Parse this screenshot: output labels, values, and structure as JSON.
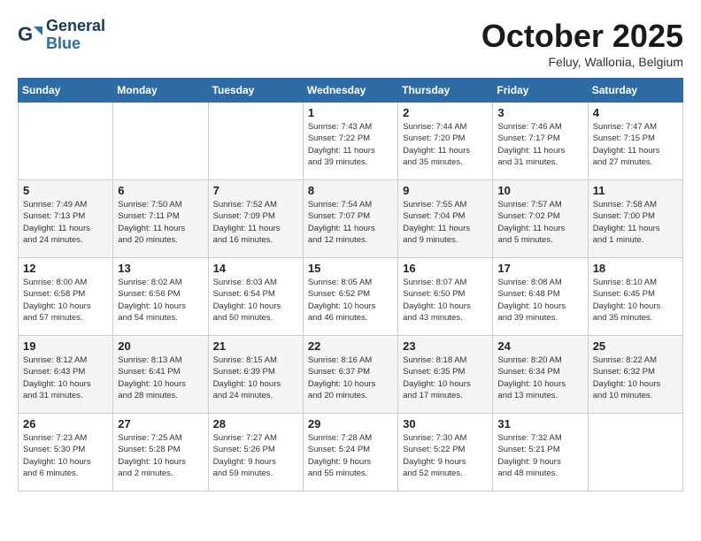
{
  "logo": {
    "line1": "General",
    "line2": "Blue"
  },
  "header": {
    "month": "October 2025",
    "location": "Feluy, Wallonia, Belgium"
  },
  "weekdays": [
    "Sunday",
    "Monday",
    "Tuesday",
    "Wednesday",
    "Thursday",
    "Friday",
    "Saturday"
  ],
  "weeks": [
    [
      {
        "day": "",
        "info": ""
      },
      {
        "day": "",
        "info": ""
      },
      {
        "day": "",
        "info": ""
      },
      {
        "day": "1",
        "info": "Sunrise: 7:43 AM\nSunset: 7:22 PM\nDaylight: 11 hours\nand 39 minutes."
      },
      {
        "day": "2",
        "info": "Sunrise: 7:44 AM\nSunset: 7:20 PM\nDaylight: 11 hours\nand 35 minutes."
      },
      {
        "day": "3",
        "info": "Sunrise: 7:46 AM\nSunset: 7:17 PM\nDaylight: 11 hours\nand 31 minutes."
      },
      {
        "day": "4",
        "info": "Sunrise: 7:47 AM\nSunset: 7:15 PM\nDaylight: 11 hours\nand 27 minutes."
      }
    ],
    [
      {
        "day": "5",
        "info": "Sunrise: 7:49 AM\nSunset: 7:13 PM\nDaylight: 11 hours\nand 24 minutes."
      },
      {
        "day": "6",
        "info": "Sunrise: 7:50 AM\nSunset: 7:11 PM\nDaylight: 11 hours\nand 20 minutes."
      },
      {
        "day": "7",
        "info": "Sunrise: 7:52 AM\nSunset: 7:09 PM\nDaylight: 11 hours\nand 16 minutes."
      },
      {
        "day": "8",
        "info": "Sunrise: 7:54 AM\nSunset: 7:07 PM\nDaylight: 11 hours\nand 12 minutes."
      },
      {
        "day": "9",
        "info": "Sunrise: 7:55 AM\nSunset: 7:04 PM\nDaylight: 11 hours\nand 9 minutes."
      },
      {
        "day": "10",
        "info": "Sunrise: 7:57 AM\nSunset: 7:02 PM\nDaylight: 11 hours\nand 5 minutes."
      },
      {
        "day": "11",
        "info": "Sunrise: 7:58 AM\nSunset: 7:00 PM\nDaylight: 11 hours\nand 1 minute."
      }
    ],
    [
      {
        "day": "12",
        "info": "Sunrise: 8:00 AM\nSunset: 6:58 PM\nDaylight: 10 hours\nand 57 minutes."
      },
      {
        "day": "13",
        "info": "Sunrise: 8:02 AM\nSunset: 6:56 PM\nDaylight: 10 hours\nand 54 minutes."
      },
      {
        "day": "14",
        "info": "Sunrise: 8:03 AM\nSunset: 6:54 PM\nDaylight: 10 hours\nand 50 minutes."
      },
      {
        "day": "15",
        "info": "Sunrise: 8:05 AM\nSunset: 6:52 PM\nDaylight: 10 hours\nand 46 minutes."
      },
      {
        "day": "16",
        "info": "Sunrise: 8:07 AM\nSunset: 6:50 PM\nDaylight: 10 hours\nand 43 minutes."
      },
      {
        "day": "17",
        "info": "Sunrise: 8:08 AM\nSunset: 6:48 PM\nDaylight: 10 hours\nand 39 minutes."
      },
      {
        "day": "18",
        "info": "Sunrise: 8:10 AM\nSunset: 6:45 PM\nDaylight: 10 hours\nand 35 minutes."
      }
    ],
    [
      {
        "day": "19",
        "info": "Sunrise: 8:12 AM\nSunset: 6:43 PM\nDaylight: 10 hours\nand 31 minutes."
      },
      {
        "day": "20",
        "info": "Sunrise: 8:13 AM\nSunset: 6:41 PM\nDaylight: 10 hours\nand 28 minutes."
      },
      {
        "day": "21",
        "info": "Sunrise: 8:15 AM\nSunset: 6:39 PM\nDaylight: 10 hours\nand 24 minutes."
      },
      {
        "day": "22",
        "info": "Sunrise: 8:16 AM\nSunset: 6:37 PM\nDaylight: 10 hours\nand 20 minutes."
      },
      {
        "day": "23",
        "info": "Sunrise: 8:18 AM\nSunset: 6:35 PM\nDaylight: 10 hours\nand 17 minutes."
      },
      {
        "day": "24",
        "info": "Sunrise: 8:20 AM\nSunset: 6:34 PM\nDaylight: 10 hours\nand 13 minutes."
      },
      {
        "day": "25",
        "info": "Sunrise: 8:22 AM\nSunset: 6:32 PM\nDaylight: 10 hours\nand 10 minutes."
      }
    ],
    [
      {
        "day": "26",
        "info": "Sunrise: 7:23 AM\nSunset: 5:30 PM\nDaylight: 10 hours\nand 6 minutes."
      },
      {
        "day": "27",
        "info": "Sunrise: 7:25 AM\nSunset: 5:28 PM\nDaylight: 10 hours\nand 2 minutes."
      },
      {
        "day": "28",
        "info": "Sunrise: 7:27 AM\nSunset: 5:26 PM\nDaylight: 9 hours\nand 59 minutes."
      },
      {
        "day": "29",
        "info": "Sunrise: 7:28 AM\nSunset: 5:24 PM\nDaylight: 9 hours\nand 55 minutes."
      },
      {
        "day": "30",
        "info": "Sunrise: 7:30 AM\nSunset: 5:22 PM\nDaylight: 9 hours\nand 52 minutes."
      },
      {
        "day": "31",
        "info": "Sunrise: 7:32 AM\nSunset: 5:21 PM\nDaylight: 9 hours\nand 48 minutes."
      },
      {
        "day": "",
        "info": ""
      }
    ]
  ]
}
